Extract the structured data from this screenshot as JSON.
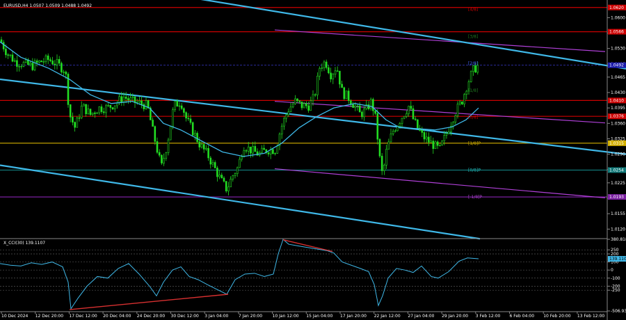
{
  "chart_data": {
    "type": "candlestick",
    "symbol_title": "EURUSD,H4  1.0507 1.0509 1.0488 1.0492",
    "indicator_title": "X_CCI(30) 139.1107",
    "price_axis": {
      "ylim": [
        1.01,
        1.064
      ],
      "ticks": [
        "1.0600",
        "1.0565",
        "1.0530",
        "1.0495",
        "1.0465",
        "1.0430",
        "1.0395",
        "1.0360",
        "1.0325",
        "1.0290",
        "1.0255",
        "1.0225",
        "1.0190",
        "1.0155",
        "1.0120"
      ]
    },
    "price_tags": [
      {
        "text": "1.0620",
        "value": 1.0623,
        "color": "#cc0000"
      },
      {
        "text": "1.0566",
        "value": 1.0568,
        "color": "#cc0000"
      },
      {
        "text": "1.0492",
        "value": 1.0492,
        "color": "#1a1aaa"
      },
      {
        "text": "1.0410",
        "value": 1.0412,
        "color": "#cc0000"
      },
      {
        "text": "1.0376",
        "value": 1.0376,
        "color": "#cc0000"
      },
      {
        "text": "1.0315",
        "value": 1.0315,
        "color": "#d4b000"
      },
      {
        "text": "1.0254",
        "value": 1.0254,
        "color": "#107878"
      },
      {
        "text": "1.0193",
        "value": 1.0193,
        "color": "#7a1fa0"
      }
    ],
    "murrey_labels": [
      {
        "text": "[4/8]",
        "value": 1.0619,
        "color": "#cc0000"
      },
      {
        "text": "[3/8]",
        "value": 1.0557,
        "color": "#1f7a1f"
      },
      {
        "text": "[2/8]",
        "value": 1.0496,
        "color": "#4466ff"
      },
      {
        "text": "[1/8]",
        "value": 1.0435,
        "color": "#1f7a1f"
      },
      {
        "text": "[0/8]",
        "value": 1.0374,
        "color": "#cc0000"
      },
      {
        "text": "[1/8]P",
        "value": 1.0315,
        "color": "#d4b000"
      },
      {
        "text": "[0/8]P",
        "value": 1.0254,
        "color": "#22bbbb"
      },
      {
        "text": "[-1/8]P",
        "value": 1.0193,
        "color": "#aa44cc"
      }
    ],
    "x_labels": [
      "10 Dec 2024",
      "12 Dec 20:00",
      "17 Dec 12:00",
      "20 Dec 04:00",
      "24 Dec 20:00",
      "30 Dec 12:00",
      "3 Jan 04:00",
      "7 Jan 20:00",
      "10 Jan 12:00",
      "15 Jan 04:00",
      "17 Jan 20:00",
      "22 Jan 12:00",
      "27 Jan 04:00",
      "29 Jan 20:00",
      "3 Feb 12:00",
      "6 Feb 04:00",
      "10 Feb 20:00",
      "13 Feb 12:00"
    ],
    "close_path": [
      [
        0,
        1.055
      ],
      [
        10,
        1.052
      ],
      [
        22,
        1.05
      ],
      [
        34,
        1.0495
      ],
      [
        46,
        1.049
      ],
      [
        58,
        1.05
      ],
      [
        70,
        1.0505
      ],
      [
        82,
        1.0495
      ],
      [
        94,
        1.048
      ],
      [
        100,
        1.038
      ],
      [
        108,
        1.035
      ],
      [
        118,
        1.04
      ],
      [
        130,
        1.038
      ],
      [
        142,
        1.0395
      ],
      [
        154,
        1.0395
      ],
      [
        166,
        1.0405
      ],
      [
        178,
        1.042
      ],
      [
        190,
        1.041
      ],
      [
        202,
        1.0405
      ],
      [
        212,
        1.04
      ],
      [
        220,
        1.034
      ],
      [
        232,
        1.026
      ],
      [
        240,
        1.031
      ],
      [
        250,
        1.04
      ],
      [
        260,
        1.041
      ],
      [
        268,
        1.037
      ],
      [
        278,
        1.034
      ],
      [
        288,
        1.031
      ],
      [
        298,
        1.029
      ],
      [
        308,
        1.026
      ],
      [
        318,
        1.023
      ],
      [
        326,
        1.021
      ],
      [
        334,
        1.024
      ],
      [
        342,
        1.026
      ],
      [
        350,
        1.031
      ],
      [
        360,
        1.03
      ],
      [
        372,
        1.029
      ],
      [
        384,
        1.03
      ],
      [
        396,
        1.03
      ],
      [
        404,
        1.035
      ],
      [
        414,
        1.039
      ],
      [
        424,
        1.041
      ],
      [
        434,
        1.04
      ],
      [
        444,
        1.04
      ],
      [
        452,
        1.042
      ],
      [
        460,
        1.049
      ],
      [
        468,
        1.05
      ],
      [
        476,
        1.047
      ],
      [
        484,
        1.049
      ],
      [
        492,
        1.043
      ],
      [
        500,
        1.042
      ],
      [
        510,
        1.04
      ],
      [
        518,
        1.038
      ],
      [
        526,
        1.039
      ],
      [
        534,
        1.041
      ],
      [
        540,
        1.037
      ],
      [
        546,
        1.028
      ],
      [
        550,
        1.024
      ],
      [
        556,
        1.03
      ],
      [
        564,
        1.034
      ],
      [
        572,
        1.036
      ],
      [
        580,
        1.038
      ],
      [
        588,
        1.04
      ],
      [
        594,
        1.037
      ],
      [
        600,
        1.035
      ],
      [
        608,
        1.033
      ],
      [
        616,
        1.032
      ],
      [
        624,
        1.031
      ],
      [
        632,
        1.03
      ],
      [
        640,
        1.033
      ],
      [
        648,
        1.036
      ],
      [
        656,
        1.039
      ],
      [
        664,
        1.041
      ],
      [
        672,
        1.045
      ],
      [
        680,
        1.048
      ],
      [
        688,
        1.0492
      ]
    ],
    "ma_path": [
      [
        0,
        1.0545
      ],
      [
        30,
        1.051
      ],
      [
        70,
        1.0485
      ],
      [
        100,
        1.046
      ],
      [
        130,
        1.0425
      ],
      [
        160,
        1.0405
      ],
      [
        190,
        1.041
      ],
      [
        215,
        1.0395
      ],
      [
        235,
        1.036
      ],
      [
        260,
        1.0345
      ],
      [
        290,
        1.032
      ],
      [
        320,
        1.0295
      ],
      [
        350,
        1.0285
      ],
      [
        380,
        1.0292
      ],
      [
        405,
        1.0315
      ],
      [
        430,
        1.035
      ],
      [
        455,
        1.0375
      ],
      [
        480,
        1.0395
      ],
      [
        510,
        1.0405
      ],
      [
        535,
        1.0398
      ],
      [
        555,
        1.0368
      ],
      [
        575,
        1.035
      ],
      [
        600,
        1.0348
      ],
      [
        625,
        1.0345
      ],
      [
        650,
        1.0352
      ],
      [
        670,
        1.0368
      ],
      [
        688,
        1.0395
      ]
    ],
    "trend_channel": [
      {
        "p1": [
          0,
          1.046
        ],
        "p2": [
          900,
          1.029
        ],
        "color": "#3fb8e8"
      },
      {
        "p1": [
          210,
          1.0662
        ],
        "p2": [
          900,
          1.0484
        ],
        "color": "#3fb8e8"
      },
      {
        "p1": [
          0,
          1.0265
        ],
        "p2": [
          690,
          1.0098
        ],
        "color": "#3fb8e8"
      }
    ],
    "regression_channel": [
      {
        "p1": [
          395,
          1.0572
        ],
        "p2": [
          870,
          1.0523
        ],
        "color": "#b040d8"
      },
      {
        "p1": [
          395,
          1.041
        ],
        "p2": [
          870,
          1.0361
        ],
        "color": "#b040d8"
      },
      {
        "p1": [
          395,
          1.0257
        ],
        "p2": [
          870,
          1.0191
        ],
        "color": "#b040d8"
      }
    ],
    "cci": {
      "ylim": [
        -506.931,
        380.8188
      ],
      "ticks": [
        "380.8188",
        "250",
        "200",
        "100",
        "0",
        "-100",
        "-200",
        "-250",
        "-506.931"
      ],
      "value_label": "139.1107",
      "path": [
        [
          0,
          80
        ],
        [
          15,
          60
        ],
        [
          30,
          50
        ],
        [
          45,
          90
        ],
        [
          60,
          70
        ],
        [
          75,
          100
        ],
        [
          90,
          40
        ],
        [
          98,
          -150
        ],
        [
          102,
          -480
        ],
        [
          112,
          -350
        ],
        [
          125,
          -200
        ],
        [
          140,
          -80
        ],
        [
          155,
          -100
        ],
        [
          170,
          20
        ],
        [
          185,
          80
        ],
        [
          200,
          -50
        ],
        [
          215,
          -200
        ],
        [
          225,
          -320
        ],
        [
          235,
          -150
        ],
        [
          248,
          0
        ],
        [
          260,
          40
        ],
        [
          272,
          -80
        ],
        [
          285,
          -120
        ],
        [
          298,
          -180
        ],
        [
          312,
          -240
        ],
        [
          326,
          -300
        ],
        [
          338,
          -120
        ],
        [
          352,
          -50
        ],
        [
          366,
          -40
        ],
        [
          380,
          -80
        ],
        [
          393,
          -50
        ],
        [
          400,
          200
        ],
        [
          407,
          380
        ],
        [
          415,
          320
        ],
        [
          428,
          300
        ],
        [
          442,
          280
        ],
        [
          456,
          260
        ],
        [
          470,
          240
        ],
        [
          480,
          210
        ],
        [
          492,
          100
        ],
        [
          505,
          60
        ],
        [
          518,
          20
        ],
        [
          530,
          -20
        ],
        [
          538,
          -180
        ],
        [
          544,
          -440
        ],
        [
          550,
          -320
        ],
        [
          558,
          -100
        ],
        [
          570,
          20
        ],
        [
          582,
          0
        ],
        [
          594,
          -30
        ],
        [
          606,
          50
        ],
        [
          620,
          -80
        ],
        [
          630,
          -100
        ],
        [
          645,
          -20
        ],
        [
          660,
          110
        ],
        [
          672,
          150
        ],
        [
          688,
          139
        ]
      ],
      "trendlines": [
        {
          "p1": [
            100,
            -490
          ],
          "p2": [
            328,
            -300
          ],
          "color": "#d83030"
        },
        {
          "p1": [
            407,
            375
          ],
          "p2": [
            478,
            230
          ],
          "color": "#d83030"
        }
      ]
    }
  }
}
